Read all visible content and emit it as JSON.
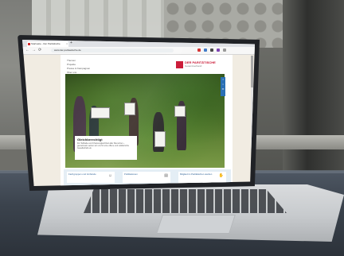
{
  "browser": {
    "tab_title": "Startseite - Der Paritätische",
    "url": "www.der-paritaetische.de",
    "tab_close": "×",
    "new_tab": "+",
    "nav": {
      "back": "←",
      "forward": "→",
      "reload": "⟳"
    }
  },
  "website": {
    "menu": [
      "Themen",
      "Projekte",
      "Presse & Kampagnen",
      "Über uns"
    ],
    "logo": {
      "name": "DER PARITÄTISCHE",
      "subline": "Gesamtverband"
    },
    "hero_card": {
      "title": "Gleichberechtigt",
      "text": "Für Teilhabe und Chancengleichheit aller Menschen – gemeinsam setzen wir uns für eine offene und solidarische Gesellschaft ein."
    },
    "side_rail": [
      "f",
      "t",
      "✉"
    ],
    "quick_links": [
      {
        "label": "Fachgruppen und Verbände",
        "icon": "group-icon"
      },
      {
        "label": "Publikationen",
        "icon": "document-icon"
      },
      {
        "label": "Mitglied im Paritätischen werden",
        "icon": "handshake-icon"
      }
    ]
  },
  "colors": {
    "brand_red": "#c8102e",
    "link_blue": "#2a5f94"
  }
}
